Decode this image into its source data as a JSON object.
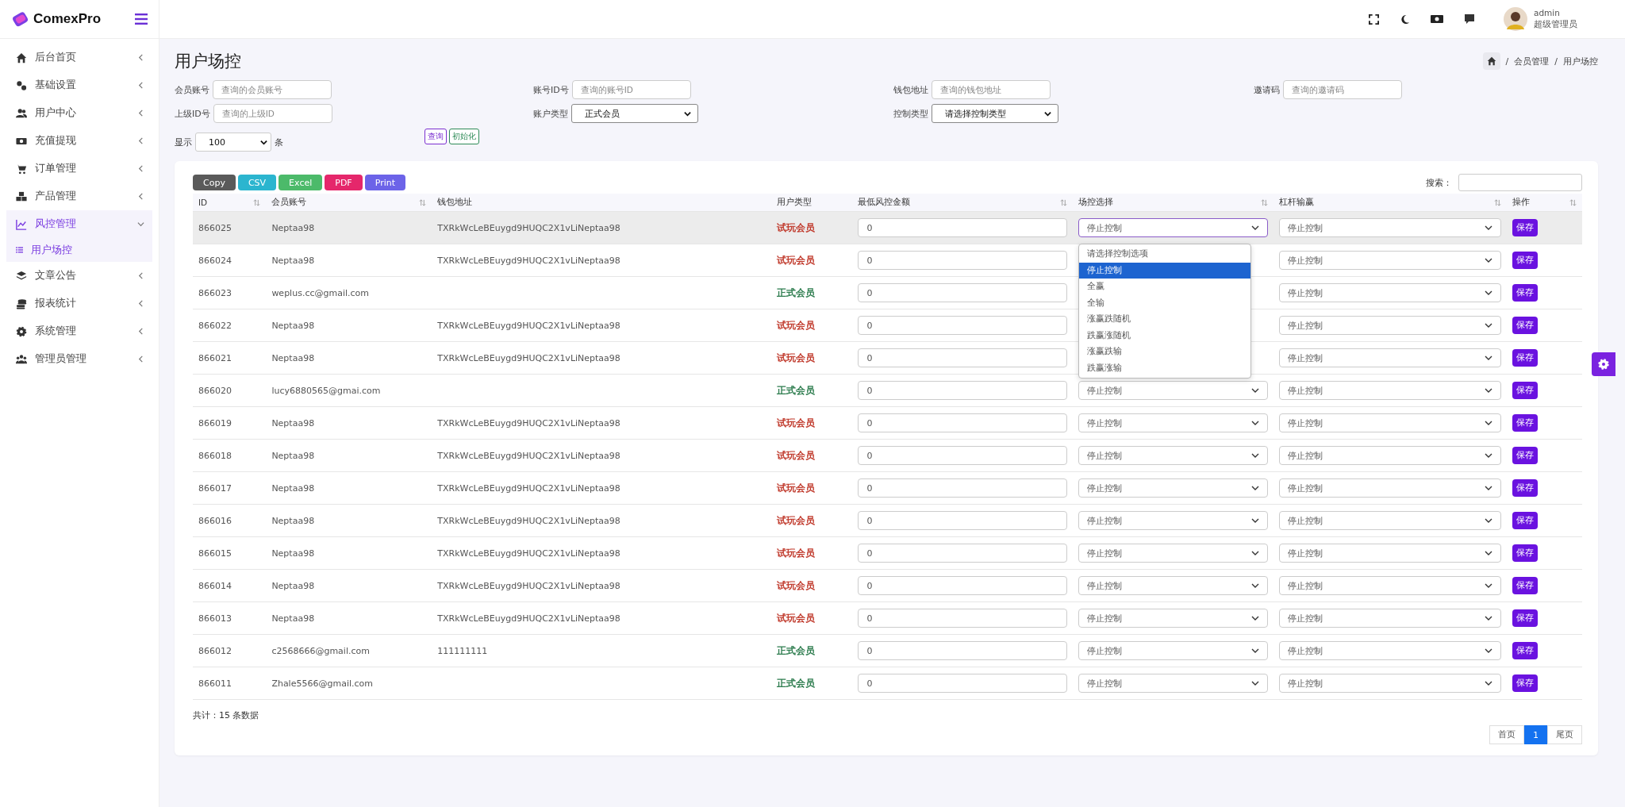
{
  "brand": {
    "name": "ComexPro"
  },
  "sidebar": {
    "items": [
      {
        "label": "后台首页",
        "expanded": false,
        "selected": false
      },
      {
        "label": "基础设置",
        "expanded": false,
        "selected": false
      },
      {
        "label": "用户中心",
        "expanded": false,
        "selected": false
      },
      {
        "label": "充值提现",
        "expanded": false,
        "selected": false
      },
      {
        "label": "订单管理",
        "expanded": false,
        "selected": false
      },
      {
        "label": "产品管理",
        "expanded": false,
        "selected": false
      },
      {
        "label": "风控管理",
        "expanded": true,
        "selected": true,
        "children": [
          {
            "label": "用户场控",
            "selected": true
          }
        ]
      },
      {
        "label": "文章公告",
        "expanded": false,
        "selected": false
      },
      {
        "label": "报表统计",
        "expanded": false,
        "selected": false
      },
      {
        "label": "系统管理",
        "expanded": false,
        "selected": false
      },
      {
        "label": "管理员管理",
        "expanded": false,
        "selected": false
      }
    ]
  },
  "topbar": {
    "user": {
      "name": "admin",
      "role": "超级管理员"
    }
  },
  "page": {
    "title": "用户场控",
    "breadcrumb": [
      {
        "separator": "/",
        "label": "会员管理"
      },
      {
        "separator": "/",
        "label": "用户场控"
      }
    ]
  },
  "filters": [
    {
      "kind": "input",
      "label": "会员账号",
      "placeholder": "查询的会员账号"
    },
    {
      "kind": "input",
      "label": "账号ID号",
      "placeholder": "查询的账号ID"
    },
    {
      "kind": "input",
      "label": "钱包地址",
      "placeholder": "查询的钱包地址"
    },
    {
      "kind": "input",
      "label": "邀请码",
      "placeholder": "查询的邀请码"
    },
    {
      "kind": "input",
      "label": "上级ID号",
      "placeholder": "查询的上级ID"
    },
    {
      "kind": "select",
      "label": "账户类型",
      "value": "正式会员"
    },
    {
      "kind": "select",
      "label": "控制类型",
      "value": "请选择控制类型"
    }
  ],
  "page_size": {
    "label": "显示",
    "value": "100",
    "unit": "条"
  },
  "actions": [
    {
      "label": "查询",
      "color": "#7b2fd0"
    },
    {
      "label": "初始化",
      "color": "#2e8b57"
    }
  ],
  "export_buttons": [
    {
      "label": "Copy",
      "color": "#5a5a5a"
    },
    {
      "label": "CSV",
      "color": "#2bb5cf"
    },
    {
      "label": "Excel",
      "color": "#4cba6a"
    },
    {
      "label": "PDF",
      "color": "#e5276b"
    },
    {
      "label": "Print",
      "color": "#6c63e8"
    }
  ],
  "search": {
    "label": "搜索："
  },
  "table": {
    "columns": [
      {
        "label": "ID",
        "sortable": true
      },
      {
        "label": "会员账号",
        "sortable": true
      },
      {
        "label": "钱包地址",
        "sortable": false
      },
      {
        "label": "用户类型",
        "sortable": false
      },
      {
        "label": "最低风控金额",
        "sortable": true
      },
      {
        "label": "场控选择",
        "sortable": true
      },
      {
        "label": "杠杆输赢",
        "sortable": true
      },
      {
        "label": "操作",
        "sortable": true
      }
    ],
    "rows": [
      {
        "id": "866025",
        "account": "Neptaa98",
        "wallet": "TXRkWcLeBEuygd9HUQC2X1vLiNeptaa98",
        "type": {
          "text": "试玩会员",
          "color": "#c0392b"
        },
        "amount": "0",
        "scene": "停止控制",
        "lever": "停止控制",
        "action": "保存",
        "selected": true
      },
      {
        "id": "866024",
        "account": "Neptaa98",
        "wallet": "TXRkWcLeBEuygd9HUQC2X1vLiNeptaa98",
        "type": {
          "text": "试玩会员",
          "color": "#c0392b"
        },
        "amount": "0",
        "lever": "停止控制",
        "action": "保存",
        "selected": false
      },
      {
        "id": "866023",
        "account": "weplus.cc@gmail.com",
        "type": {
          "text": "正式会员",
          "color": "#2e7d4f"
        },
        "amount": "0",
        "lever": "停止控制",
        "action": "保存",
        "selected": false
      },
      {
        "id": "866022",
        "account": "Neptaa98",
        "wallet": "TXRkWcLeBEuygd9HUQC2X1vLiNeptaa98",
        "type": {
          "text": "试玩会员",
          "color": "#c0392b"
        },
        "amount": "0",
        "lever": "停止控制",
        "action": "保存",
        "selected": false
      },
      {
        "id": "866021",
        "account": "Neptaa98",
        "wallet": "TXRkWcLeBEuygd9HUQC2X1vLiNeptaa98",
        "type": {
          "text": "试玩会员",
          "color": "#c0392b"
        },
        "amount": "0",
        "lever": "停止控制",
        "action": "保存",
        "selected": false
      },
      {
        "id": "866020",
        "account": "lucy6880565@gmai.com",
        "type": {
          "text": "正式会员",
          "color": "#2e7d4f"
        },
        "amount": "0",
        "scene": "停止控制",
        "lever": "停止控制",
        "action": "保存",
        "selected": false
      },
      {
        "id": "866019",
        "account": "Neptaa98",
        "wallet": "TXRkWcLeBEuygd9HUQC2X1vLiNeptaa98",
        "type": {
          "text": "试玩会员",
          "color": "#c0392b"
        },
        "amount": "0",
        "scene": "停止控制",
        "lever": "停止控制",
        "action": "保存",
        "selected": false
      },
      {
        "id": "866018",
        "account": "Neptaa98",
        "wallet": "TXRkWcLeBEuygd9HUQC2X1vLiNeptaa98",
        "type": {
          "text": "试玩会员",
          "color": "#c0392b"
        },
        "amount": "0",
        "scene": "停止控制",
        "lever": "停止控制",
        "action": "保存",
        "selected": false
      },
      {
        "id": "866017",
        "account": "Neptaa98",
        "wallet": "TXRkWcLeBEuygd9HUQC2X1vLiNeptaa98",
        "type": {
          "text": "试玩会员",
          "color": "#c0392b"
        },
        "amount": "0",
        "scene": "停止控制",
        "lever": "停止控制",
        "action": "保存",
        "selected": false
      },
      {
        "id": "866016",
        "account": "Neptaa98",
        "wallet": "TXRkWcLeBEuygd9HUQC2X1vLiNeptaa98",
        "type": {
          "text": "试玩会员",
          "color": "#c0392b"
        },
        "amount": "0",
        "scene": "停止控制",
        "lever": "停止控制",
        "action": "保存",
        "selected": false
      },
      {
        "id": "866015",
        "account": "Neptaa98",
        "wallet": "TXRkWcLeBEuygd9HUQC2X1vLiNeptaa98",
        "type": {
          "text": "试玩会员",
          "color": "#c0392b"
        },
        "amount": "0",
        "scene": "停止控制",
        "lever": "停止控制",
        "action": "保存",
        "selected": false
      },
      {
        "id": "866014",
        "account": "Neptaa98",
        "wallet": "TXRkWcLeBEuygd9HUQC2X1vLiNeptaa98",
        "type": {
          "text": "试玩会员",
          "color": "#c0392b"
        },
        "amount": "0",
        "scene": "停止控制",
        "lever": "停止控制",
        "action": "保存",
        "selected": false
      },
      {
        "id": "866013",
        "account": "Neptaa98",
        "wallet": "TXRkWcLeBEuygd9HUQC2X1vLiNeptaa98",
        "type": {
          "text": "试玩会员",
          "color": "#c0392b"
        },
        "amount": "0",
        "scene": "停止控制",
        "lever": "停止控制",
        "action": "保存",
        "selected": false
      },
      {
        "id": "866012",
        "account": "c2568666@gmail.com",
        "wallet": "111111111",
        "type": {
          "text": "正式会员",
          "color": "#2e7d4f"
        },
        "amount": "0",
        "scene": "停止控制",
        "lever": "停止控制",
        "action": "保存",
        "selected": false
      },
      {
        "id": "866011",
        "account": "Zhale5566@gmail.com",
        "type": {
          "text": "正式会员",
          "color": "#2e7d4f"
        },
        "amount": "0",
        "scene": "停止控制",
        "lever": "停止控制",
        "action": "保存",
        "selected": false
      }
    ],
    "scene_dropdown": {
      "options": [
        {
          "label": "请选择控制选项",
          "selected": false
        },
        {
          "label": "停止控制",
          "selected": true
        },
        {
          "label": "全赢",
          "selected": false
        },
        {
          "label": "全输",
          "selected": false
        },
        {
          "label": "涨赢跌随机",
          "selected": false
        },
        {
          "label": "跌赢涨随机",
          "selected": false
        },
        {
          "label": "涨赢跌输",
          "selected": false
        },
        {
          "label": "跌赢涨输",
          "selected": false
        }
      ]
    }
  },
  "footer": {
    "total": "共计：15 条数据"
  },
  "pagination": [
    {
      "label": "首页",
      "selected": false
    },
    {
      "label": "1",
      "selected": true
    },
    {
      "label": "尾页",
      "selected": false
    }
  ]
}
